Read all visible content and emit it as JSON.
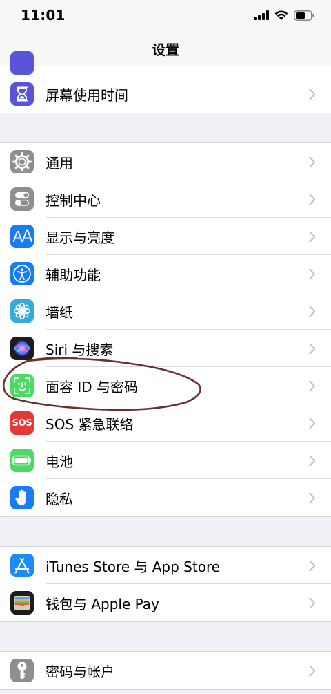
{
  "status_bar": {
    "time": "11:01"
  },
  "nav": {
    "title": "设置"
  },
  "groups": [
    {
      "items": [
        {
          "label": "屏幕使用时间",
          "icon": "hourglass-icon",
          "color": "#5856d6"
        }
      ]
    },
    {
      "items": [
        {
          "label": "通用",
          "icon": "gear-icon",
          "color": "#8e8e93"
        },
        {
          "label": "控制中心",
          "icon": "toggles-icon",
          "color": "#8e8e93"
        },
        {
          "label": "显示与亮度",
          "icon": "aa-icon",
          "color": "#1a7cf5"
        },
        {
          "label": "辅助功能",
          "icon": "accessibility-icon",
          "color": "#1a7cf5"
        },
        {
          "label": "墙纸",
          "icon": "flower-icon",
          "color": "#35aadc"
        },
        {
          "label": "Siri 与搜索",
          "icon": "siri-icon",
          "color": "#1c1c1e"
        },
        {
          "label": "面容 ID 与密码",
          "icon": "face-id-icon",
          "color": "#4cd964"
        },
        {
          "label": "SOS 紧急联络",
          "icon": "sos-icon",
          "color": "#e53935",
          "icon_text": "SOS"
        },
        {
          "label": "电池",
          "icon": "battery-icon",
          "color": "#4cd964"
        },
        {
          "label": "隐私",
          "icon": "hand-icon",
          "color": "#1a7cf5"
        }
      ]
    },
    {
      "items": [
        {
          "label": "iTunes Store 与 App Store",
          "icon": "app-store-icon",
          "color": "#1a8cf7"
        },
        {
          "label": "钱包与 Apple Pay",
          "icon": "wallet-icon",
          "color": "#1c1c1e"
        }
      ]
    },
    {
      "items": [
        {
          "label": "密码与帐户",
          "icon": "key-icon",
          "color": "#8e8e93"
        }
      ]
    }
  ]
}
